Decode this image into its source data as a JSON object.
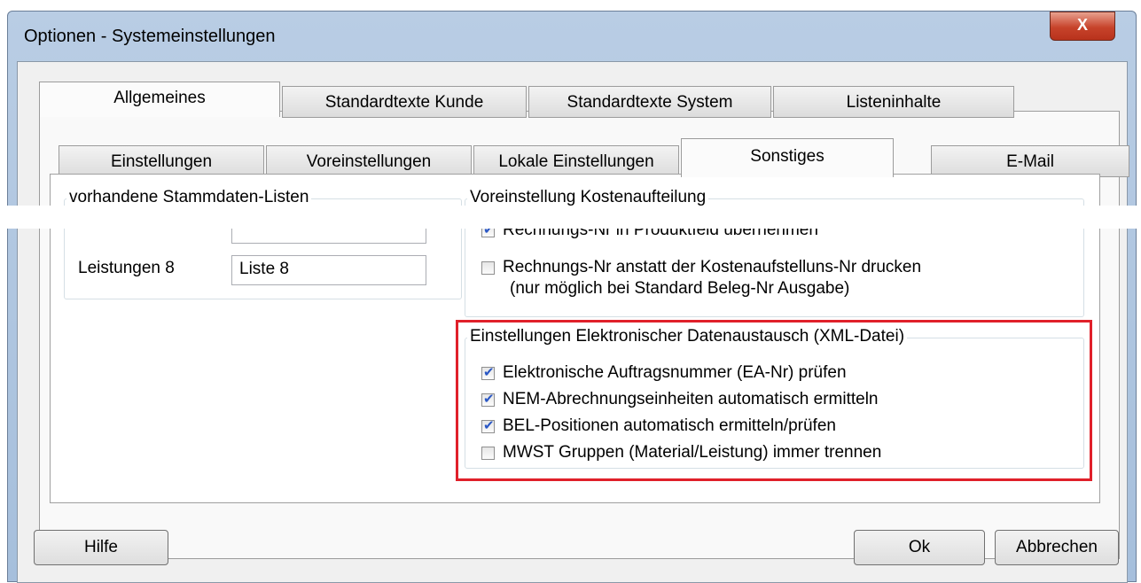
{
  "window": {
    "title": "Optionen - Systemeinstellungen",
    "close_glyph": "X"
  },
  "tabs_top": [
    "Allgemeines",
    "Standardtexte Kunde",
    "Standardtexte System",
    "Listeninhalte"
  ],
  "tabs_sub": [
    "Einstellungen",
    "Voreinstellungen",
    "Lokale Einstellungen",
    "Sonstiges",
    "E-Mail"
  ],
  "stammdaten": {
    "label": "vorhandene Stammdaten-Listen",
    "row_label": "Leistungen 8",
    "row_value": "Liste 8"
  },
  "kosten": {
    "label": "Voreinstellung Kostenaufteilung",
    "cb1": "Rechnungs-Nr in Produktfeld übernehmen",
    "cb2_line1": "Rechnungs-Nr anstatt der Kostenaufstelluns-Nr drucken",
    "cb2_line2": "(nur möglich bei Standard Beleg-Nr Ausgabe)"
  },
  "xml": {
    "label": "Einstellungen Elektronischer Datenaustausch (XML-Datei)",
    "items": [
      "Elektronische Auftragsnummer (EA-Nr) prüfen",
      "NEM-Abrechnungseinheiten automatisch ermitteln",
      "BEL-Positionen automatisch ermitteln/prüfen",
      "MWST Gruppen (Material/Leistung) immer trennen"
    ]
  },
  "buttons": {
    "help": "Hilfe",
    "ok": "Ok",
    "cancel": "Abbrechen"
  }
}
